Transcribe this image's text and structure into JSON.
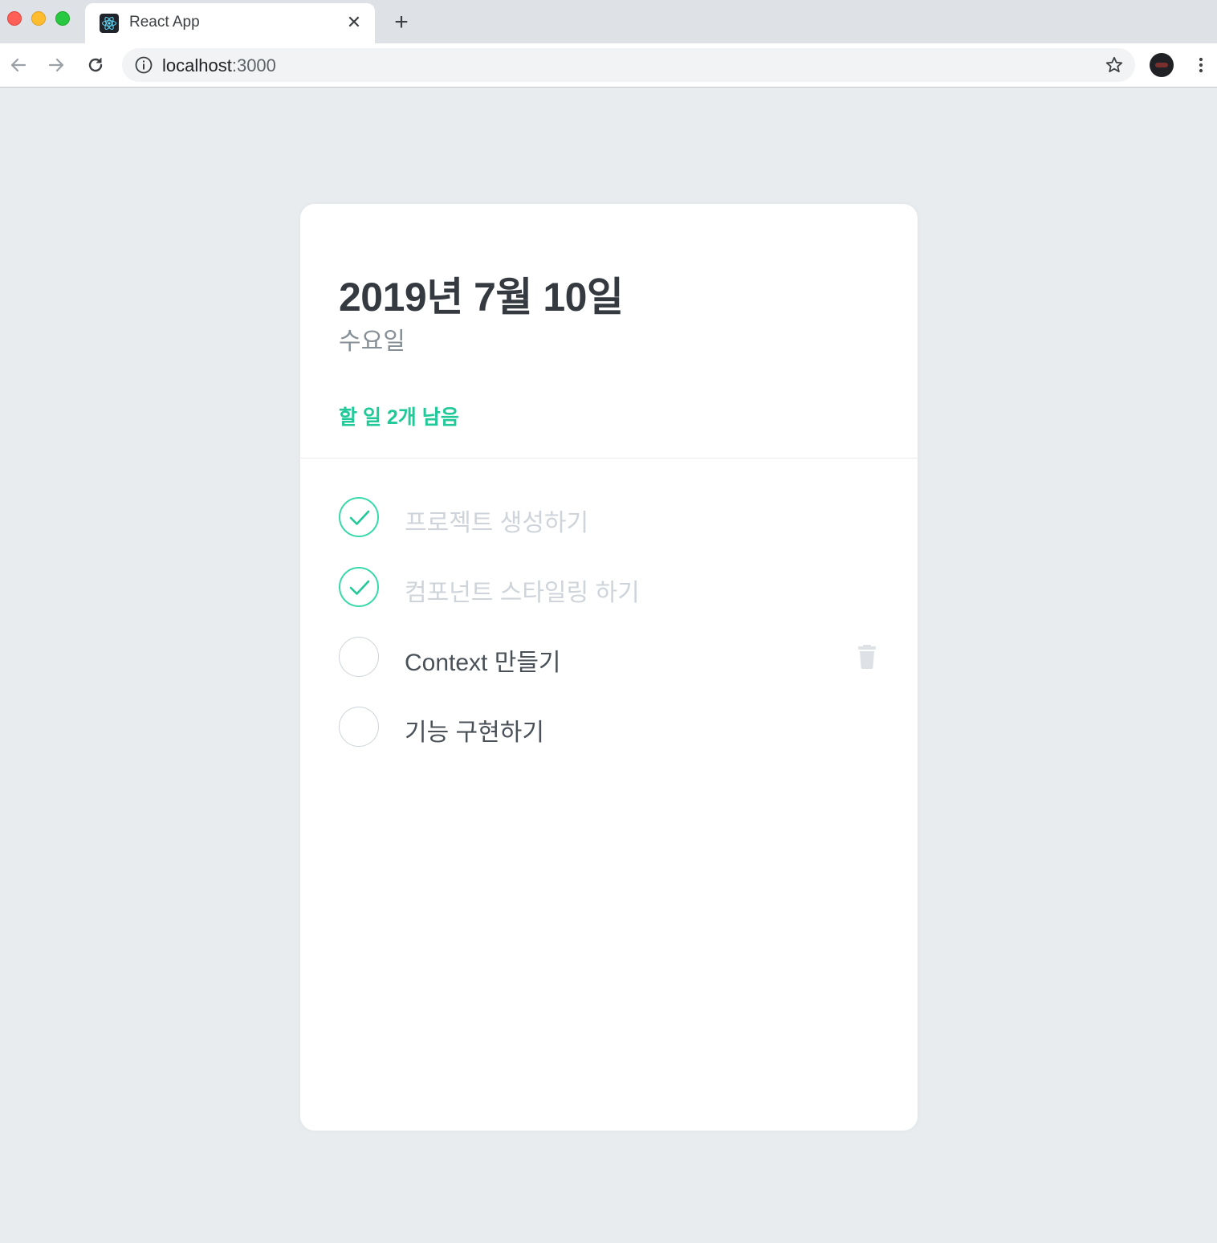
{
  "browser": {
    "tab_title": "React App",
    "tab_close": "✕",
    "new_tab": "+",
    "url_host": "localhost",
    "url_port": ":3000"
  },
  "app": {
    "date": "2019년 7월 10일",
    "day": "수요일",
    "tasks_left": "할 일 2개 남음",
    "accent_color": "#20c997",
    "todos": [
      {
        "text": "프로젝트 생성하기",
        "done": true
      },
      {
        "text": "컴포넌트 스타일링 하기",
        "done": true
      },
      {
        "text": "Context 만들기",
        "done": false
      },
      {
        "text": "기능 구현하기",
        "done": false
      }
    ]
  }
}
